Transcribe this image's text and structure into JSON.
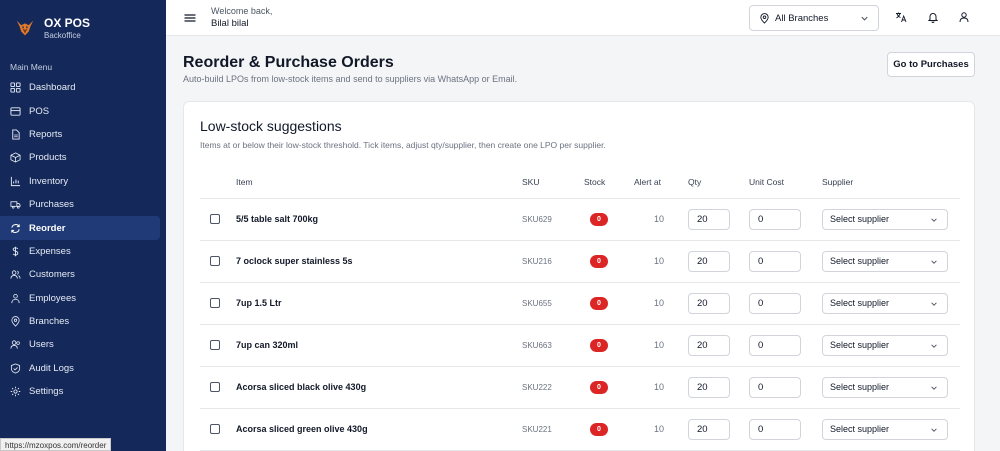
{
  "brand": {
    "title": "OX POS",
    "subtitle": "Backoffice"
  },
  "sidebar": {
    "heading": "Main Menu",
    "items": [
      {
        "label": "Dashboard",
        "icon": "dashboard-icon",
        "active": false
      },
      {
        "label": "POS",
        "icon": "pos-icon",
        "active": false
      },
      {
        "label": "Reports",
        "icon": "reports-icon",
        "active": false
      },
      {
        "label": "Products",
        "icon": "box-icon",
        "active": false
      },
      {
        "label": "Inventory",
        "icon": "chart-icon",
        "active": false
      },
      {
        "label": "Purchases",
        "icon": "truck-icon",
        "active": false
      },
      {
        "label": "Reorder",
        "icon": "refresh-icon",
        "active": true
      },
      {
        "label": "Expenses",
        "icon": "dollar-icon",
        "active": false
      },
      {
        "label": "Customers",
        "icon": "users-icon",
        "active": false
      },
      {
        "label": "Employees",
        "icon": "employees-icon",
        "active": false
      },
      {
        "label": "Branches",
        "icon": "map-pin-icon",
        "active": false
      },
      {
        "label": "Users",
        "icon": "user-group-icon",
        "active": false
      },
      {
        "label": "Audit Logs",
        "icon": "shield-icon",
        "active": false
      },
      {
        "label": "Settings",
        "icon": "gear-icon",
        "active": false
      }
    ]
  },
  "status_url": "https://mzoxpos.com/reorder",
  "topbar": {
    "welcome": "Welcome back,",
    "user_name": "Bilal bilal",
    "branch": "All Branches"
  },
  "page": {
    "title": "Reorder & Purchase Orders",
    "subtitle": "Auto-build LPOs from low-stock items and send to suppliers via WhatsApp or Email.",
    "purchases_button": "Go to Purchases"
  },
  "card": {
    "title": "Low-stock suggestions",
    "subtitle": "Items at or below their low-stock threshold. Tick items, adjust qty/supplier, then create one LPO per supplier.",
    "columns": [
      "Item",
      "SKU",
      "Stock",
      "Alert at",
      "Qty",
      "Unit Cost",
      "Supplier"
    ],
    "rows": [
      {
        "item": "5/5 table salt 700kg",
        "sku": "SKU629",
        "stock": "0",
        "alert": "10",
        "qty": "20",
        "cost": "0",
        "supplier": "Select supplier"
      },
      {
        "item": "7 oclock super stainless 5s",
        "sku": "SKU216",
        "stock": "0",
        "alert": "10",
        "qty": "20",
        "cost": "0",
        "supplier": "Select supplier"
      },
      {
        "item": "7up 1.5 Ltr",
        "sku": "SKU655",
        "stock": "0",
        "alert": "10",
        "qty": "20",
        "cost": "0",
        "supplier": "Select supplier"
      },
      {
        "item": "7up can 320ml",
        "sku": "SKU663",
        "stock": "0",
        "alert": "10",
        "qty": "20",
        "cost": "0",
        "supplier": "Select supplier"
      },
      {
        "item": "Acorsa sliced black olive 430g",
        "sku": "SKU222",
        "stock": "0",
        "alert": "10",
        "qty": "20",
        "cost": "0",
        "supplier": "Select supplier"
      },
      {
        "item": "Acorsa sliced green olive 430g",
        "sku": "SKU221",
        "stock": "0",
        "alert": "10",
        "qty": "20",
        "cost": "0",
        "supplier": "Select supplier"
      }
    ]
  },
  "colors": {
    "sidebar": "#14295a",
    "active": "#1f3a76",
    "badge": "#dc2626"
  }
}
